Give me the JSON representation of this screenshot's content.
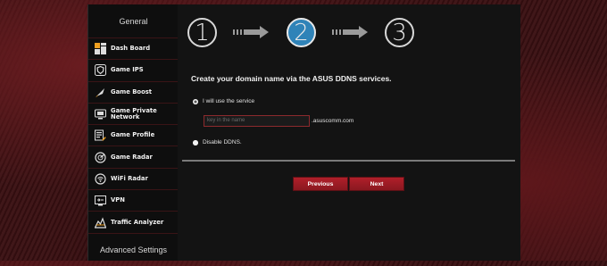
{
  "sidebar": {
    "general_label": "General",
    "advanced_label": "Advanced Settings",
    "items": [
      {
        "label": "Dash Board",
        "icon": "dashboard-icon"
      },
      {
        "label": "Game IPS",
        "icon": "shield-icon"
      },
      {
        "label": "Game Boost",
        "icon": "rocket-icon"
      },
      {
        "label": "Game Private Network",
        "icon": "network-icon"
      },
      {
        "label": "Game Profile",
        "icon": "profile-icon"
      },
      {
        "label": "Game Radar",
        "icon": "radar-icon"
      },
      {
        "label": "WiFi Radar",
        "icon": "wifi-icon"
      },
      {
        "label": "VPN",
        "icon": "vpn-icon"
      },
      {
        "label": "Traffic Analyzer",
        "icon": "traffic-icon"
      }
    ]
  },
  "wizard": {
    "steps": [
      "1",
      "2",
      "3"
    ],
    "active_step": 2,
    "heading": "Create your domain name via the ASUS DDNS services.",
    "option_use": "I will use the service",
    "domain_placeholder": "key in the name",
    "domain_suffix": ".asuscomm.com",
    "option_disable": "Disable DDNS.",
    "previous_label": "Previous",
    "next_label": "Next"
  },
  "colors": {
    "accent_red": "#b01f2a",
    "active_step_blue": "#2f83b8",
    "sidebar_bg": "#0e0e0e",
    "main_bg": "#131313"
  }
}
